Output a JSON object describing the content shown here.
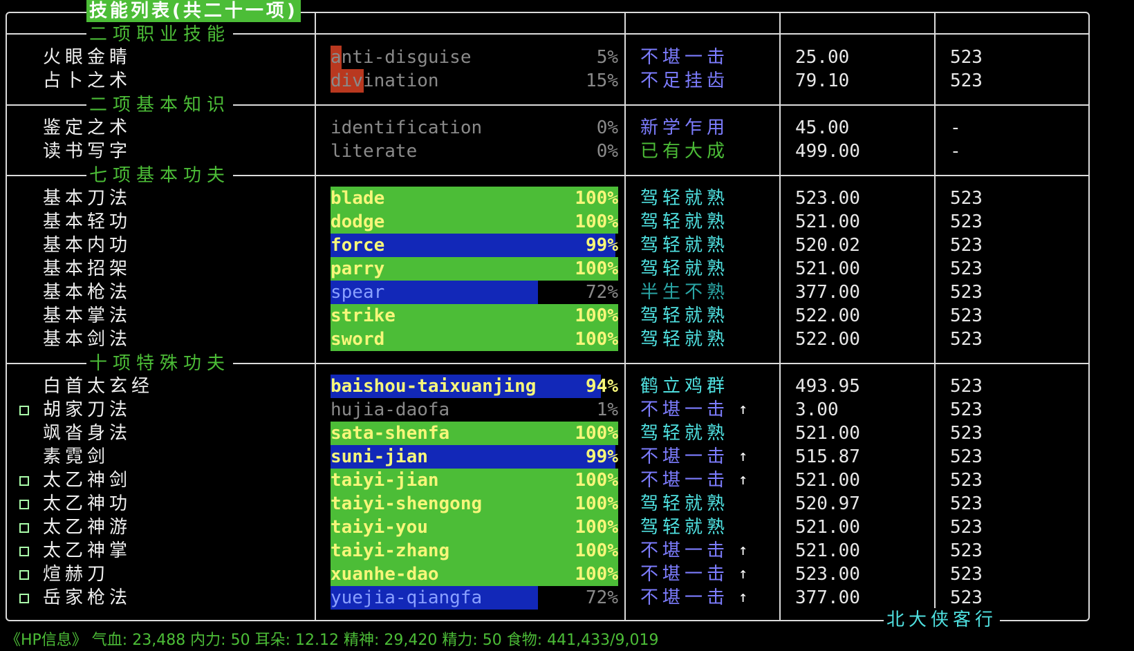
{
  "title": "技能列表(共二十一项)",
  "footer": "北大侠客行",
  "bottom_status": "《HP信息》 气血: 23,488  内力: 50  耳朵: 12.12  精神: 29,420  精力: 50  食物: 441,433/9,019",
  "colors": {
    "green_bar": "#4cbd37",
    "blue_bar": "#1228b8",
    "red_bar": "#b9381f",
    "level_blue": "#7d7dff",
    "level_cyan": "#4fe0e0",
    "level_green": "#4cbd37",
    "level_darkcyan": "#2aa6a6"
  },
  "sections": [
    {
      "label": "二项职业技能",
      "rows": [
        {
          "checkbox": false,
          "name": "火眼金睛",
          "ename": "anti-disguise",
          "pct": "5%",
          "pct_value": 5,
          "bar": "red",
          "level": "不堪一击",
          "level_color": "#7d7dff",
          "arrow": "",
          "value": "25.00",
          "max": "523"
        },
        {
          "checkbox": false,
          "name": "占卜之术",
          "ename": "divination",
          "pct": "15%",
          "pct_value": 15,
          "bar": "red",
          "level": "不足挂齿",
          "level_color": "#7d7dff",
          "arrow": "",
          "value": "79.10",
          "max": "523"
        }
      ]
    },
    {
      "label": "二项基本知识",
      "rows": [
        {
          "checkbox": false,
          "name": "鉴定之术",
          "ename": "identification",
          "pct": "0%",
          "pct_value": 0,
          "bar": "none",
          "level": "新学乍用",
          "level_color": "#7d7dff",
          "arrow": "",
          "value": "45.00",
          "max": "-"
        },
        {
          "checkbox": false,
          "name": "读书写字",
          "ename": "literate",
          "pct": "0%",
          "pct_value": 0,
          "bar": "none",
          "level": "已有大成",
          "level_color": "#4cbd37",
          "arrow": "",
          "value": "499.00",
          "max": "-"
        }
      ]
    },
    {
      "label": "七项基本功夫",
      "rows": [
        {
          "checkbox": false,
          "name": "基本刀法",
          "ename": "blade",
          "pct": "100%",
          "pct_value": 100,
          "bar": "green",
          "level": "驾轻就熟",
          "level_color": "#4fe0e0",
          "arrow": "",
          "value": "523.00",
          "max": "523"
        },
        {
          "checkbox": false,
          "name": "基本轻功",
          "ename": "dodge",
          "pct": "100%",
          "pct_value": 100,
          "bar": "green",
          "level": "驾轻就熟",
          "level_color": "#4fe0e0",
          "arrow": "",
          "value": "521.00",
          "max": "523"
        },
        {
          "checkbox": false,
          "name": "基本内功",
          "ename": "force",
          "pct": "99%",
          "pct_value": 99,
          "bar": "blue",
          "level": "驾轻就熟",
          "level_color": "#4fe0e0",
          "arrow": "",
          "value": "520.02",
          "max": "523"
        },
        {
          "checkbox": false,
          "name": "基本招架",
          "ename": "parry",
          "pct": "100%",
          "pct_value": 100,
          "bar": "green",
          "level": "驾轻就熟",
          "level_color": "#4fe0e0",
          "arrow": "",
          "value": "521.00",
          "max": "523"
        },
        {
          "checkbox": false,
          "name": "基本枪法",
          "ename": "spear",
          "pct": "72%",
          "pct_value": 72,
          "bar": "blue",
          "level": "半生不熟",
          "level_color": "#2aa6a6",
          "arrow": "",
          "value": "377.00",
          "max": "523"
        },
        {
          "checkbox": false,
          "name": "基本掌法",
          "ename": "strike",
          "pct": "100%",
          "pct_value": 100,
          "bar": "green",
          "level": "驾轻就熟",
          "level_color": "#4fe0e0",
          "arrow": "",
          "value": "522.00",
          "max": "523"
        },
        {
          "checkbox": false,
          "name": "基本剑法",
          "ename": "sword",
          "pct": "100%",
          "pct_value": 100,
          "bar": "green",
          "level": "驾轻就熟",
          "level_color": "#4fe0e0",
          "arrow": "",
          "value": "522.00",
          "max": "523"
        }
      ]
    },
    {
      "label": "十项特殊功夫",
      "rows": [
        {
          "checkbox": false,
          "name": "白首太玄经",
          "ename": "baishou-taixuanjing",
          "pct": "94%",
          "pct_value": 94,
          "bar": "blue",
          "level": "鹤立鸡群",
          "level_color": "#4fe0e0",
          "arrow": "",
          "value": "493.95",
          "max": "523"
        },
        {
          "checkbox": true,
          "name": "胡家刀法",
          "ename": "hujia-daofa",
          "pct": "1%",
          "pct_value": 1,
          "bar": "none",
          "level": "不堪一击",
          "level_color": "#7d7dff",
          "arrow": "↑",
          "value": "3.00",
          "max": "523"
        },
        {
          "checkbox": false,
          "name": "飒沓身法",
          "ename": "sata-shenfa",
          "pct": "100%",
          "pct_value": 100,
          "bar": "green",
          "level": "驾轻就熟",
          "level_color": "#4fe0e0",
          "arrow": "",
          "value": "521.00",
          "max": "523"
        },
        {
          "checkbox": false,
          "name": "素霓剑",
          "ename": "suni-jian",
          "pct": "99%",
          "pct_value": 99,
          "bar": "blue",
          "level": "不堪一击",
          "level_color": "#7d7dff",
          "arrow": "↑",
          "value": "515.87",
          "max": "523"
        },
        {
          "checkbox": true,
          "name": "太乙神剑",
          "ename": "taiyi-jian",
          "pct": "100%",
          "pct_value": 100,
          "bar": "green",
          "level": "不堪一击",
          "level_color": "#7d7dff",
          "arrow": "↑",
          "value": "521.00",
          "max": "523"
        },
        {
          "checkbox": true,
          "name": "太乙神功",
          "ename": "taiyi-shengong",
          "pct": "100%",
          "pct_value": 100,
          "bar": "green",
          "level": "驾轻就熟",
          "level_color": "#4fe0e0",
          "arrow": "",
          "value": "520.97",
          "max": "523"
        },
        {
          "checkbox": true,
          "name": "太乙神游",
          "ename": "taiyi-you",
          "pct": "100%",
          "pct_value": 100,
          "bar": "green",
          "level": "驾轻就熟",
          "level_color": "#4fe0e0",
          "arrow": "",
          "value": "521.00",
          "max": "523"
        },
        {
          "checkbox": true,
          "name": "太乙神掌",
          "ename": "taiyi-zhang",
          "pct": "100%",
          "pct_value": 100,
          "bar": "green",
          "level": "不堪一击",
          "level_color": "#7d7dff",
          "arrow": "↑",
          "value": "521.00",
          "max": "523"
        },
        {
          "checkbox": true,
          "name": "煊赫刀",
          "ename": "xuanhe-dao",
          "pct": "100%",
          "pct_value": 100,
          "bar": "green",
          "level": "不堪一击",
          "level_color": "#7d7dff",
          "arrow": "↑",
          "value": "523.00",
          "max": "523"
        },
        {
          "checkbox": true,
          "name": "岳家枪法",
          "ename": "yuejia-qiangfa",
          "pct": "72%",
          "pct_value": 72,
          "bar": "blue",
          "level": "不堪一击",
          "level_color": "#7d7dff",
          "arrow": "↑",
          "value": "377.00",
          "max": "523"
        }
      ]
    }
  ]
}
